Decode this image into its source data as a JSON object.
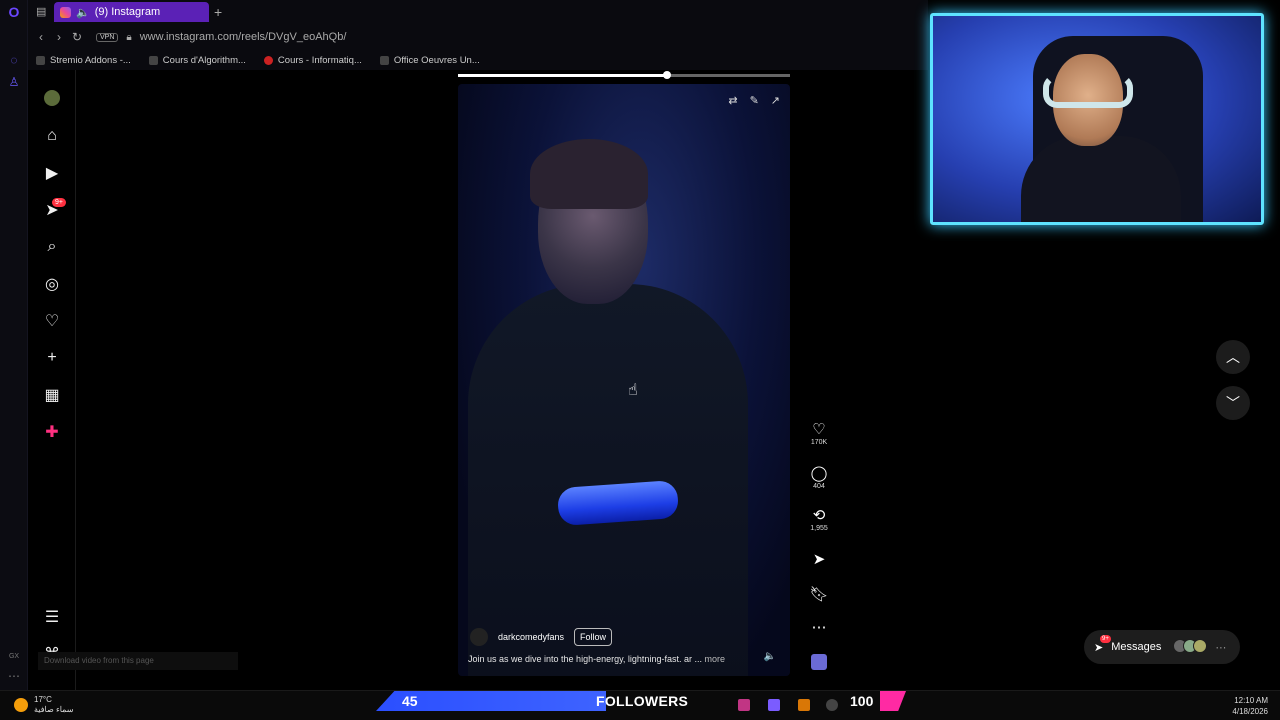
{
  "browser": {
    "tab_title": "(9) Instagram",
    "url": "www.instagram.com/reels/DVgV_eoAhQb/",
    "vpn_label": "VPN",
    "bookmarks": [
      {
        "label": "Stremio Addons -..."
      },
      {
        "label": "Cours d'Algorithm..."
      },
      {
        "label": "Cours - Informatiq..."
      },
      {
        "label": "Office Oeuvres Un..."
      }
    ]
  },
  "sidebar": {
    "notification_badge": "9+",
    "items": [
      {
        "icon": "home-icon"
      },
      {
        "icon": "reels-icon"
      },
      {
        "icon": "send-icon"
      },
      {
        "icon": "search-icon"
      },
      {
        "icon": "explore-icon"
      },
      {
        "icon": "heart-icon"
      },
      {
        "icon": "plus-icon"
      },
      {
        "icon": "insights-icon"
      },
      {
        "icon": "threads-icon"
      }
    ]
  },
  "reel": {
    "progress": 0.63,
    "author": "darkcomedyfans",
    "follow_label": "Follow",
    "caption": "Join us as we dive into the high-energy, lightning-fast. ar ...",
    "caption_more": "more",
    "likes": "170K",
    "comments": "404",
    "reposts": "1,955"
  },
  "messages": {
    "label": "Messages",
    "badge": "9+"
  },
  "download_hint": "Download video from this page",
  "taskbar": {
    "temperature": "17°C",
    "weather_text": "سماء صافية",
    "followers_left": "45",
    "followers_label": "FOLLOWERS",
    "followers_right": "100",
    "time": "12:10 AM",
    "date": "4/18/2026"
  },
  "colors": {
    "accent": "#5b21b6",
    "badge": "#ff3040",
    "webcam_glow": "#5ee3ff",
    "banner_blue": "#2b4fff"
  }
}
